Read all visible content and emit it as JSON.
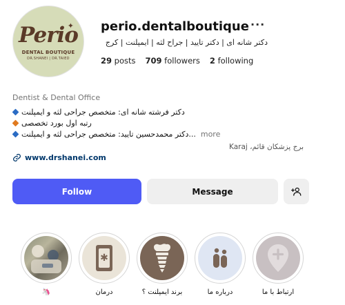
{
  "profile": {
    "username": "perio.dentalboutique",
    "more_icon": "ellipsis-icon",
    "tagline": "دکتر شانه ای | دکتر تایید | جراح لثه | ایمپلنت | کرج",
    "stats": {
      "posts_count": "29",
      "posts_label": "posts",
      "followers_count": "709",
      "followers_label": "followers",
      "following_count": "2",
      "following_label": "following"
    }
  },
  "logo": {
    "word": "Perio",
    "line1": "DENTAL BOUTIQUE",
    "line2": "DR.SHANEI | DR.TAIED"
  },
  "bio": {
    "category": "Dentist & Dental Office",
    "lines": [
      "دکتر فرشته شانه ای: متخصص جراحی لثه و ایمپلنت",
      "رتبه اول بورد تخصصی",
      "...دکتر محمدحسین تایید: متخصص جراحی لثه و ایمپلنت"
    ],
    "more_label": "more",
    "location": "برج پزشکان قائم، Karaj",
    "website": "www.drshanei.com"
  },
  "actions": {
    "follow_label": "Follow",
    "message_label": "Message",
    "suggest_icon": "add-person-icon"
  },
  "highlights": [
    {
      "label": "🦄"
    },
    {
      "label": "درمان"
    },
    {
      "label": "برند ایمپلنت ؟"
    },
    {
      "label": "درباره ما"
    },
    {
      "label": "ارتباط با ما"
    }
  ],
  "colors": {
    "follow_button": "#4f5bf5",
    "secondary_button": "#efefef",
    "link": "#00376b",
    "avatar_bg": "#d6dcb8",
    "logo_brown": "#5a3a28",
    "highlight_brown": "#7a6556",
    "highlight_blue": "#dfe6f3",
    "highlight_cream": "#eae4d8"
  }
}
